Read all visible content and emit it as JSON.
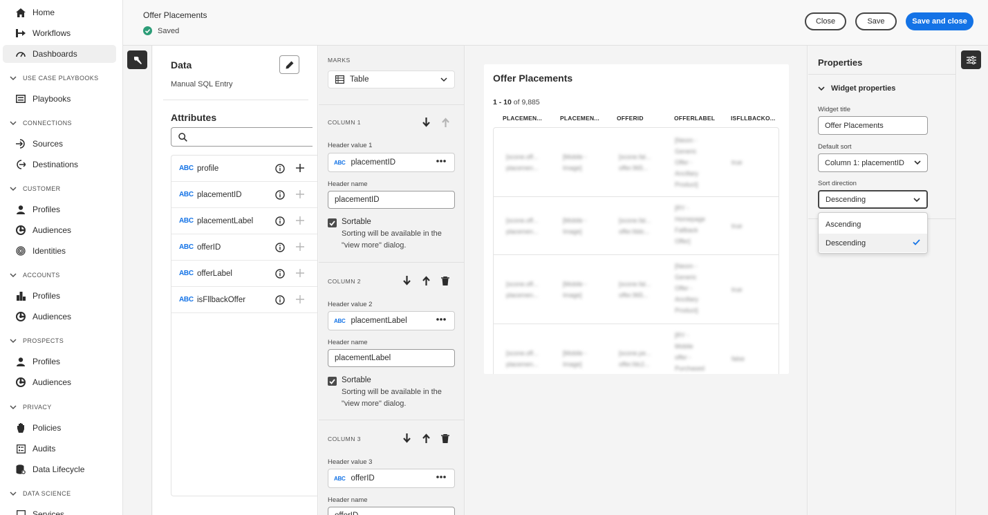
{
  "nav": {
    "items": [
      {
        "label": "Home",
        "icon": "home-icon"
      },
      {
        "label": "Workflows",
        "icon": "workflows-icon"
      },
      {
        "label": "Dashboards",
        "icon": "dashboards-icon"
      },
      {
        "label": "Playbooks",
        "icon": "playbooks-icon"
      },
      {
        "label": "Sources",
        "icon": "sources-icon"
      },
      {
        "label": "Destinations",
        "icon": "destinations-icon"
      },
      {
        "label": "Profiles",
        "icon": "profile-icon"
      },
      {
        "label": "Audiences",
        "icon": "audiences-icon"
      },
      {
        "label": "Identities",
        "icon": "identities-icon"
      },
      {
        "label": "Profiles",
        "icon": "profile-icon"
      },
      {
        "label": "Audiences",
        "icon": "audiences-icon"
      },
      {
        "label": "Profiles",
        "icon": "profile-icon"
      },
      {
        "label": "Audiences",
        "icon": "audiences-icon"
      },
      {
        "label": "Policies",
        "icon": "policies-icon"
      },
      {
        "label": "Audits",
        "icon": "audits-icon"
      },
      {
        "label": "Data Lifecycle",
        "icon": "data-lifecycle-icon"
      },
      {
        "label": "Services",
        "icon": "services-icon"
      }
    ],
    "sections": [
      "USE CASE PLAYBOOKS",
      "CONNECTIONS",
      "CUSTOMER",
      "ACCOUNTS",
      "PROSPECTS",
      "PRIVACY",
      "DATA SCIENCE"
    ]
  },
  "header": {
    "title": "Offer Placements",
    "status": "Saved",
    "close_label": "Close",
    "save_label": "Save",
    "save_close_label": "Save and close",
    "accent": "#1473e6"
  },
  "data_panel": {
    "title": "Data",
    "subtitle": "Manual SQL Entry",
    "attributes_title": "Attributes",
    "search_placeholder": "",
    "type_badge": "ABC",
    "attributes": [
      "profile",
      "placementID",
      "placementLabel",
      "offerID",
      "offerLabel",
      "isFllbackOffer"
    ]
  },
  "marks": {
    "label": "MARKS",
    "selected": "Table",
    "sortable_label": "Sortable",
    "sortable_help": "Sorting will be available in the \"view more\" dialog.",
    "columns": [
      {
        "title": "COLUMN 1",
        "hv_label": "Header value 1",
        "value": "placementID",
        "hn_label": "Header name",
        "name": "placementID"
      },
      {
        "title": "COLUMN 2",
        "hv_label": "Header value 2",
        "value": "placementLabel",
        "hn_label": "Header name",
        "name": "placementLabel"
      },
      {
        "title": "COLUMN 3",
        "hv_label": "Header value 3",
        "value": "offerID",
        "hn_label": "Header name",
        "name": "offerID"
      }
    ]
  },
  "widget": {
    "title": "Offer Placements",
    "count_range": "1 - 10",
    "count_total": "of 9,885",
    "headers": [
      "PLACEMEN...",
      "PLACEMEN...",
      "OFFERID",
      "OFFERLABEL",
      "ISFLLBACKO..."
    ],
    "rows": [
      [
        "[scone.off...\nplacemen...",
        "[Mobile -\nImage]",
        "[scone.fal...\noffer.965...",
        "[Neom -\nGeneric\nOffer -\nAncillary\nProduct]",
        "true"
      ],
      [
        "[scone.off...\nplacemen...",
        "[Mobile -\nImage]",
        "[scone.fal...\noffer.fddc...",
        "[RY -\nHomepage\nFallback\nOffer]",
        "true"
      ],
      [
        "[scone.off...\nplacemen...",
        "[Mobile -\nImage]",
        "[scone.fal...\noffer.965...",
        "[Neom -\nGeneric\nOffer -\nAncillary\nProduct]",
        "true"
      ],
      [
        "[scone.off...\nplacemen...",
        "[Mobile -\nImage]",
        "[scone.pe...\noffer.fdc2...",
        "[RY -\nMobile\noffer -\nPurchased",
        "false"
      ]
    ]
  },
  "properties": {
    "title": "Properties",
    "section": "Widget properties",
    "widget_title_label": "Widget title",
    "widget_title_value": "Offer Placements",
    "default_sort_label": "Default sort",
    "default_sort_value": "Column 1: placementID",
    "sort_direction_label": "Sort direction",
    "sort_direction_value": "Descending",
    "sort_options": [
      "Ascending",
      "Descending"
    ]
  }
}
